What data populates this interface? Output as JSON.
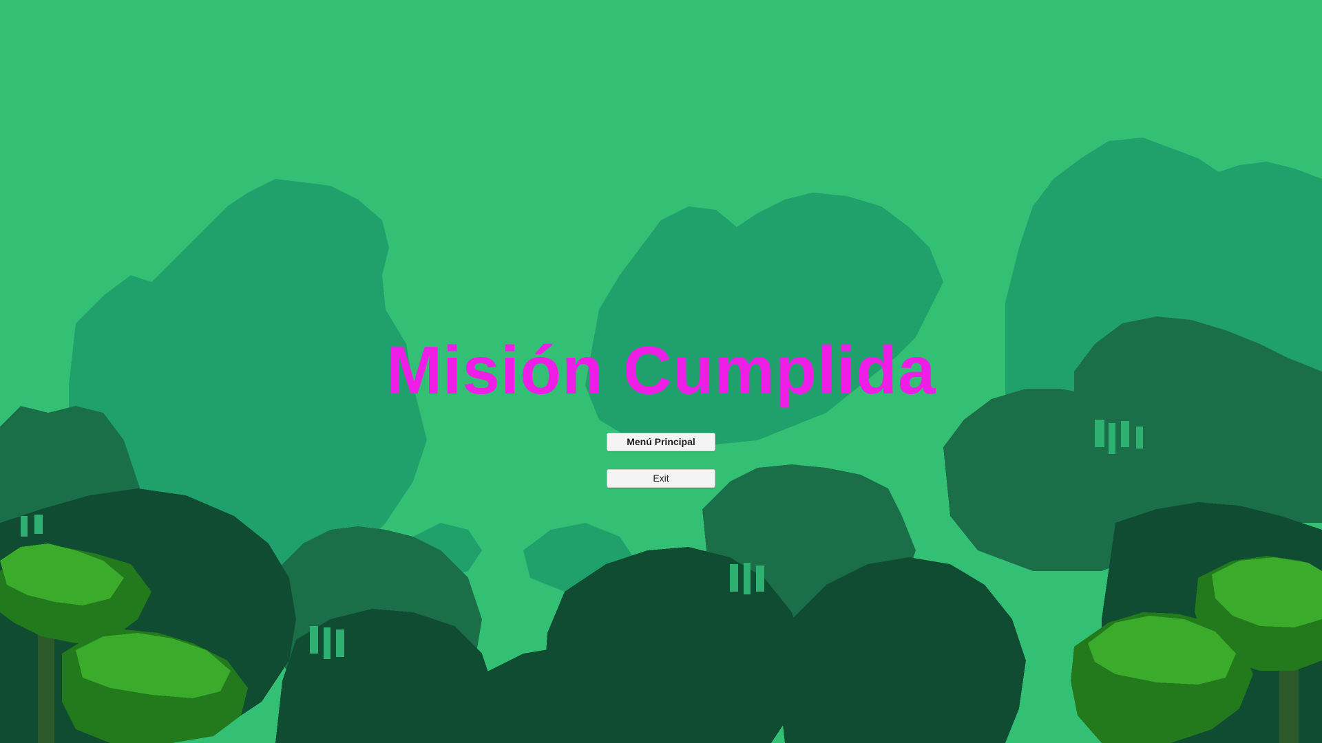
{
  "screen": {
    "title": "Misión Cumplida",
    "title_color": "#ee1ee6",
    "background_color": "#33c075"
  },
  "buttons": {
    "main_menu_label": "Menú Principal",
    "exit_label": "Exit"
  },
  "palette": {
    "sky": "#33c075",
    "far_silhouette": "#1f9f6a",
    "mid_canopy": "#1a6b45",
    "dark_canopy": "#0f4a30",
    "palm_light": "#39a829",
    "palm_dark": "#237a1c",
    "trunk": "#2c5a2a"
  }
}
